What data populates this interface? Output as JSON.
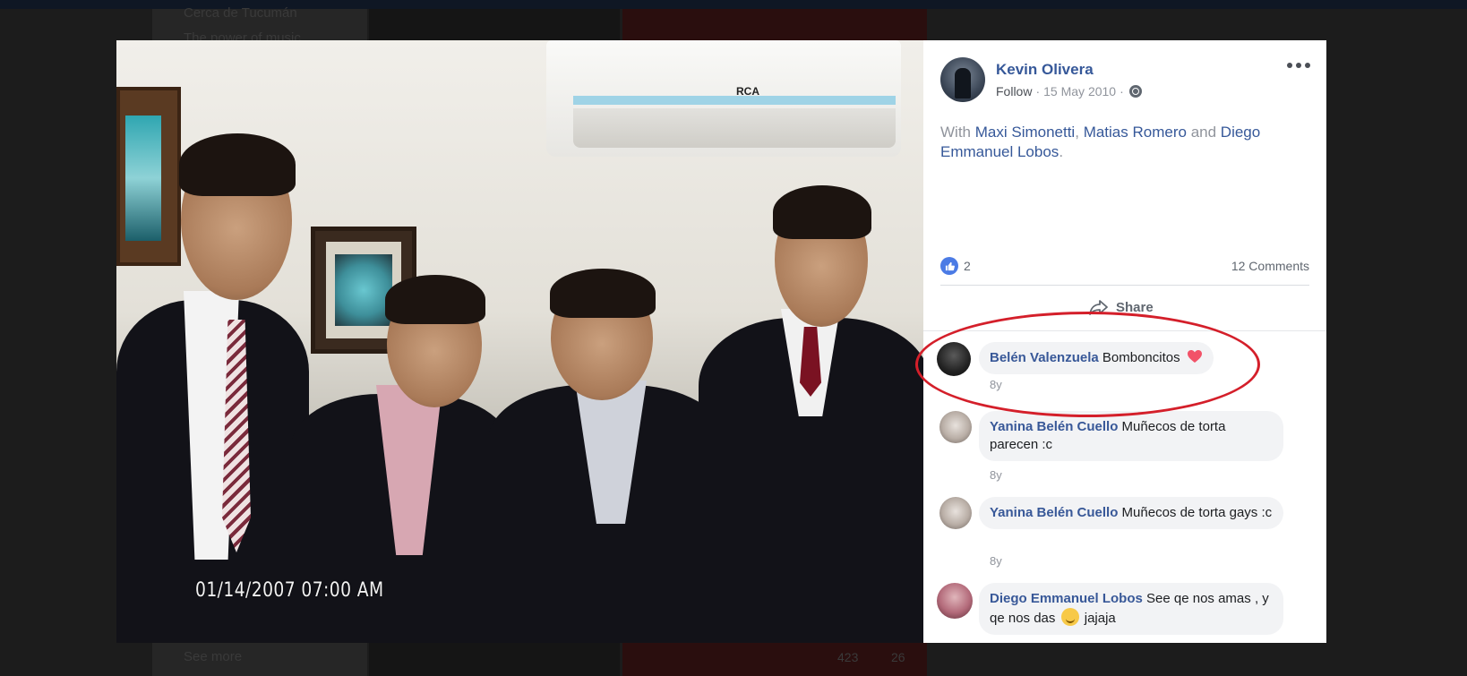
{
  "background": {
    "sidebar_items": [
      "Cerca de Tucumán",
      "The power of music",
      "See more"
    ],
    "footer_counts": {
      "likes": "423",
      "comments": "26"
    }
  },
  "photo": {
    "timestamp": "01/14/2007 07:00 AM",
    "ac_brand": "RCA"
  },
  "post": {
    "author": "Kevin Olivera",
    "follow_label": "Follow",
    "separator": "·",
    "date": "15 May 2010",
    "caption": {
      "prefix": "With",
      "tags": [
        "Maxi Simonetti",
        "Matias Romero",
        "Diego Emmanuel Lobos"
      ],
      "join_comma": ",",
      "join_and": "and",
      "suffix": "."
    },
    "likes": "2",
    "comments_label": "12 Comments",
    "share_label": "Share"
  },
  "comments": [
    {
      "name": "Belén Valenzuela",
      "text": "Bomboncitos",
      "emoji": "heart-icon",
      "time": "8y"
    },
    {
      "name": "Yanina Belén Cuello",
      "text": "Muñecos de torta parecen :c",
      "time": "8y"
    },
    {
      "name": "Yanina Belén Cuello",
      "text": "Muñecos de torta gays :c",
      "time": "8y"
    },
    {
      "name": "Diego Emmanuel Lobos",
      "text_before": "See qe nos amas , y qe nos das",
      "emoji": "smile-icon",
      "text_after": "jajaja"
    }
  ],
  "colors": {
    "link": "#365899",
    "like_blue": "#4b7be5",
    "highlight_red": "#d41f2a",
    "bubble": "#f2f3f5"
  }
}
